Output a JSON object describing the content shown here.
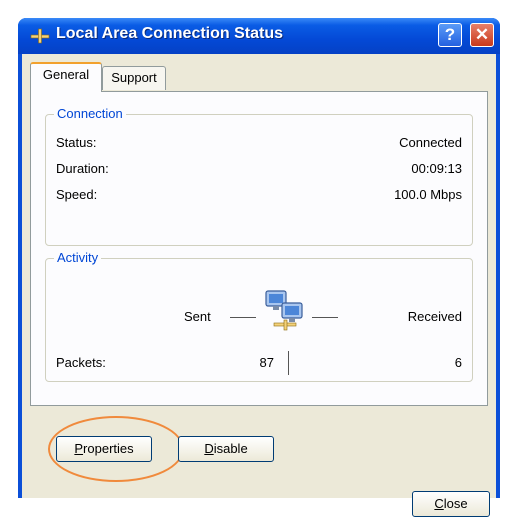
{
  "window": {
    "title": "Local Area Connection Status",
    "help_label": "?",
    "close_label": "✕"
  },
  "tabs": [
    {
      "label": "General",
      "active": true
    },
    {
      "label": "Support",
      "active": false
    }
  ],
  "connection": {
    "group_label": "Connection",
    "rows": [
      {
        "label": "Status:",
        "value": "Connected"
      },
      {
        "label": "Duration:",
        "value": "00:09:13"
      },
      {
        "label": "Speed:",
        "value": "100.0 Mbps"
      }
    ]
  },
  "activity": {
    "group_label": "Activity",
    "sent_label": "Sent",
    "received_label": "Received",
    "packets_label": "Packets:",
    "packets_sent": "87",
    "packets_received": "6",
    "icon": "network-computers-icon"
  },
  "buttons": {
    "properties_mnemonic": "P",
    "properties_rest": "roperties",
    "disable_mnemonic": "D",
    "disable_rest": "isable",
    "close_mnemonic": "C",
    "close_rest": "lose"
  },
  "colors": {
    "title_bar": "#0449d6",
    "group_label": "#0046d5",
    "highlight_circle": "#f08a3c"
  }
}
